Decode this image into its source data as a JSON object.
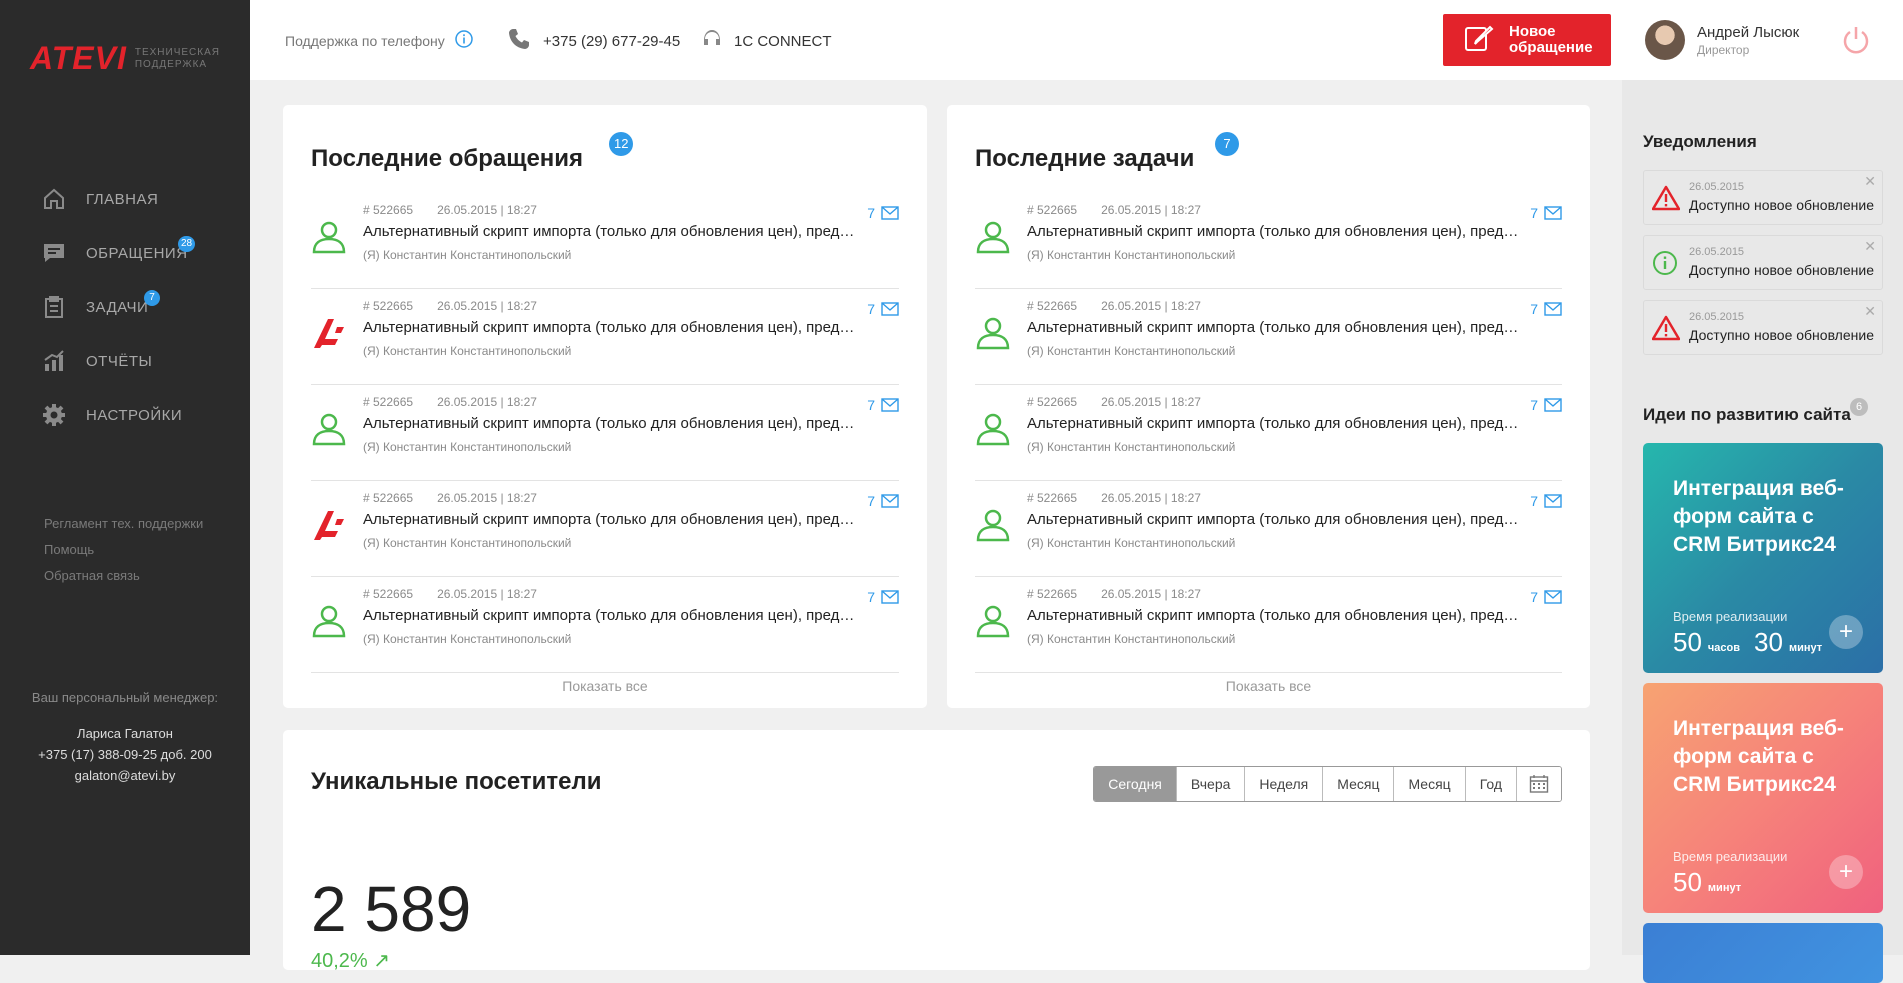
{
  "brand": {
    "logo": "ATEVI",
    "subtitle_line1": "ТЕХНИЧЕСКАЯ",
    "subtitle_line2": "ПОДДЕРЖКА"
  },
  "nav": [
    {
      "label": "ГЛАВНАЯ",
      "icon": "home-icon",
      "badge": ""
    },
    {
      "label": "ОБРАЩЕНИЯ",
      "icon": "chat-icon",
      "badge": "28"
    },
    {
      "label": "ЗАДАЧИ",
      "icon": "clipboard-icon",
      "badge": "7"
    },
    {
      "label": "ОТЧЁТЫ",
      "icon": "chart-icon",
      "badge": ""
    },
    {
      "label": "НАСТРОЙКИ",
      "icon": "gear-icon",
      "badge": ""
    }
  ],
  "links": [
    "Регламент тех. поддержки",
    "Помощь",
    "Обратная связь"
  ],
  "manager": {
    "label": "Ваш персональный менеджер:",
    "name": "Лариса Галатон",
    "phone": "+375 (17) 388-09-25 доб. 200",
    "email": "galaton@atevi.by"
  },
  "header": {
    "support_label": "Поддержка по телефону",
    "phone": "+375 (29) 677-29-45",
    "connect": "1С CONNECT",
    "new_request_line1": "Новое",
    "new_request_line2": "обращение",
    "user_name": "Андрей Лысюк",
    "user_role": "Директор"
  },
  "requests": {
    "title": "Последние обращения",
    "badge": "12",
    "show_all": "Показать все",
    "rows": [
      {
        "icon": "user-icon",
        "id": "# 522665",
        "date": "26.05.2015 | 18:27",
        "text": "Альтернативный скрипт импорта (только для обновления цен), предусмотрен",
        "author": "(Я) Константин Константинопольский",
        "count": "7"
      },
      {
        "icon": "atevi-logo-icon",
        "id": "# 522665",
        "date": "26.05.2015 | 18:27",
        "text": "Альтернативный скрипт импорта (только для обновления цен), предусмотрен",
        "author": "(Я) Константин Константинопольский",
        "count": "7"
      },
      {
        "icon": "user-icon",
        "id": "# 522665",
        "date": "26.05.2015 | 18:27",
        "text": "Альтернативный скрипт импорта (только для обновления цен), предусмотрен",
        "author": "(Я) Константин Константинопольский",
        "count": "7"
      },
      {
        "icon": "atevi-logo-icon",
        "id": "# 522665",
        "date": "26.05.2015 | 18:27",
        "text": "Альтернативный скрипт импорта (только для обновления цен), предусмотрен",
        "author": "(Я) Константин Константинопольский",
        "count": "7"
      },
      {
        "icon": "user-icon",
        "id": "# 522665",
        "date": "26.05.2015 | 18:27",
        "text": "Альтернативный скрипт импорта (только для обновления цен), предусмотрен",
        "author": "(Я) Константин Константинопольский",
        "count": "7"
      }
    ]
  },
  "tasks": {
    "title": "Последние задачи",
    "badge": "7",
    "show_all": "Показать все",
    "rows": [
      {
        "icon": "user-icon",
        "id": "# 522665",
        "date": "26.05.2015 | 18:27",
        "text": "Альтернативный скрипт импорта (только для обновления цен), предусмотрен",
        "author": "(Я) Константин Константинопольский",
        "count": "7"
      },
      {
        "icon": "user-icon",
        "id": "# 522665",
        "date": "26.05.2015 | 18:27",
        "text": "Альтернативный скрипт импорта (только для обновления цен), предусмотрен",
        "author": "(Я) Константин Константинопольский",
        "count": "7"
      },
      {
        "icon": "user-icon",
        "id": "# 522665",
        "date": "26.05.2015 | 18:27",
        "text": "Альтернативный скрипт импорта (только для обновления цен), предусмотрен",
        "author": "(Я) Константин Константинопольский",
        "count": "7"
      },
      {
        "icon": "user-icon",
        "id": "# 522665",
        "date": "26.05.2015 | 18:27",
        "text": "Альтернативный скрипт импорта (только для обновления цен), предусмотрен",
        "author": "(Я) Константин Константинопольский",
        "count": "7"
      },
      {
        "icon": "user-icon",
        "id": "# 522665",
        "date": "26.05.2015 | 18:27",
        "text": "Альтернативный скрипт импорта (только для обновления цен), предусмотрен",
        "author": "(Я) Константин Константинопольский",
        "count": "7"
      }
    ]
  },
  "visitors": {
    "title": "Уникальные посетители",
    "periods": [
      "Сегодня",
      "Вчера",
      "Неделя",
      "Месяц",
      "Месяц",
      "Год"
    ],
    "active_period": "Сегодня",
    "value": "2 589",
    "growth": "40,2% ↗"
  },
  "notifications": {
    "title": "Уведомления",
    "items": [
      {
        "type": "warning",
        "icon": "warning-icon",
        "date": "26.05.2015",
        "text": "Доступно новое обновление"
      },
      {
        "type": "info",
        "icon": "info-icon",
        "date": "26.05.2015",
        "text": "Доступно новое обновление"
      },
      {
        "type": "warning",
        "icon": "warning-icon",
        "date": "26.05.2015",
        "text": "Доступно новое обновление"
      }
    ]
  },
  "ideas": {
    "title": "Идеи по развитию сайта",
    "badge": "6",
    "items": [
      {
        "title": "Интеграция веб-форм сайта с CRM Битрикс24",
        "time_label": "Время реализации",
        "hours": "50",
        "hours_unit": "часов",
        "minutes": "30",
        "minutes_unit": "минут"
      },
      {
        "title": "Интеграция веб-форм сайта с CRM Битрикс24",
        "time_label": "Время реализации",
        "minutes": "50",
        "minutes_unit": "минут"
      }
    ]
  },
  "colors": {
    "accent_red": "#e3232b",
    "accent_blue": "#2f9ae8",
    "success_green": "#4cb84c"
  }
}
